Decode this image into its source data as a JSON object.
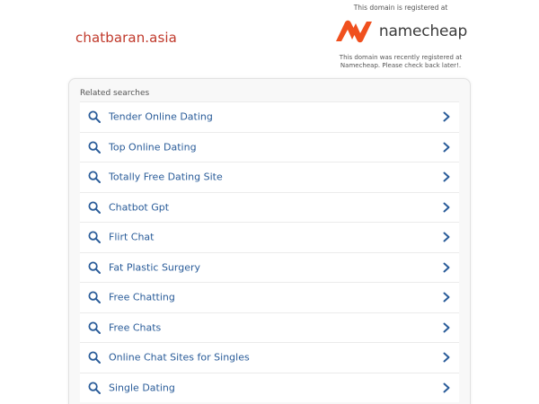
{
  "domain": "chatbaran.asia",
  "registrar": {
    "top_text": "This domain is registered at",
    "brand": "namecheap",
    "bottom_text": "This domain was recently registered at Namecheap. Please check back later!."
  },
  "related": {
    "title": "Related searches",
    "items": [
      {
        "label": "Tender Online Dating"
      },
      {
        "label": "Top Online Dating"
      },
      {
        "label": "Totally Free Dating Site"
      },
      {
        "label": "Chatbot Gpt"
      },
      {
        "label": "Flirt Chat"
      },
      {
        "label": "Fat Plastic Surgery"
      },
      {
        "label": "Free Chatting"
      },
      {
        "label": "Free Chats"
      },
      {
        "label": "Online Chat Sites for Singles"
      },
      {
        "label": "Single Dating"
      }
    ]
  },
  "colors": {
    "domain": "#c0392b",
    "link": "#2a5c99",
    "brand_orange": "#f0501e"
  }
}
